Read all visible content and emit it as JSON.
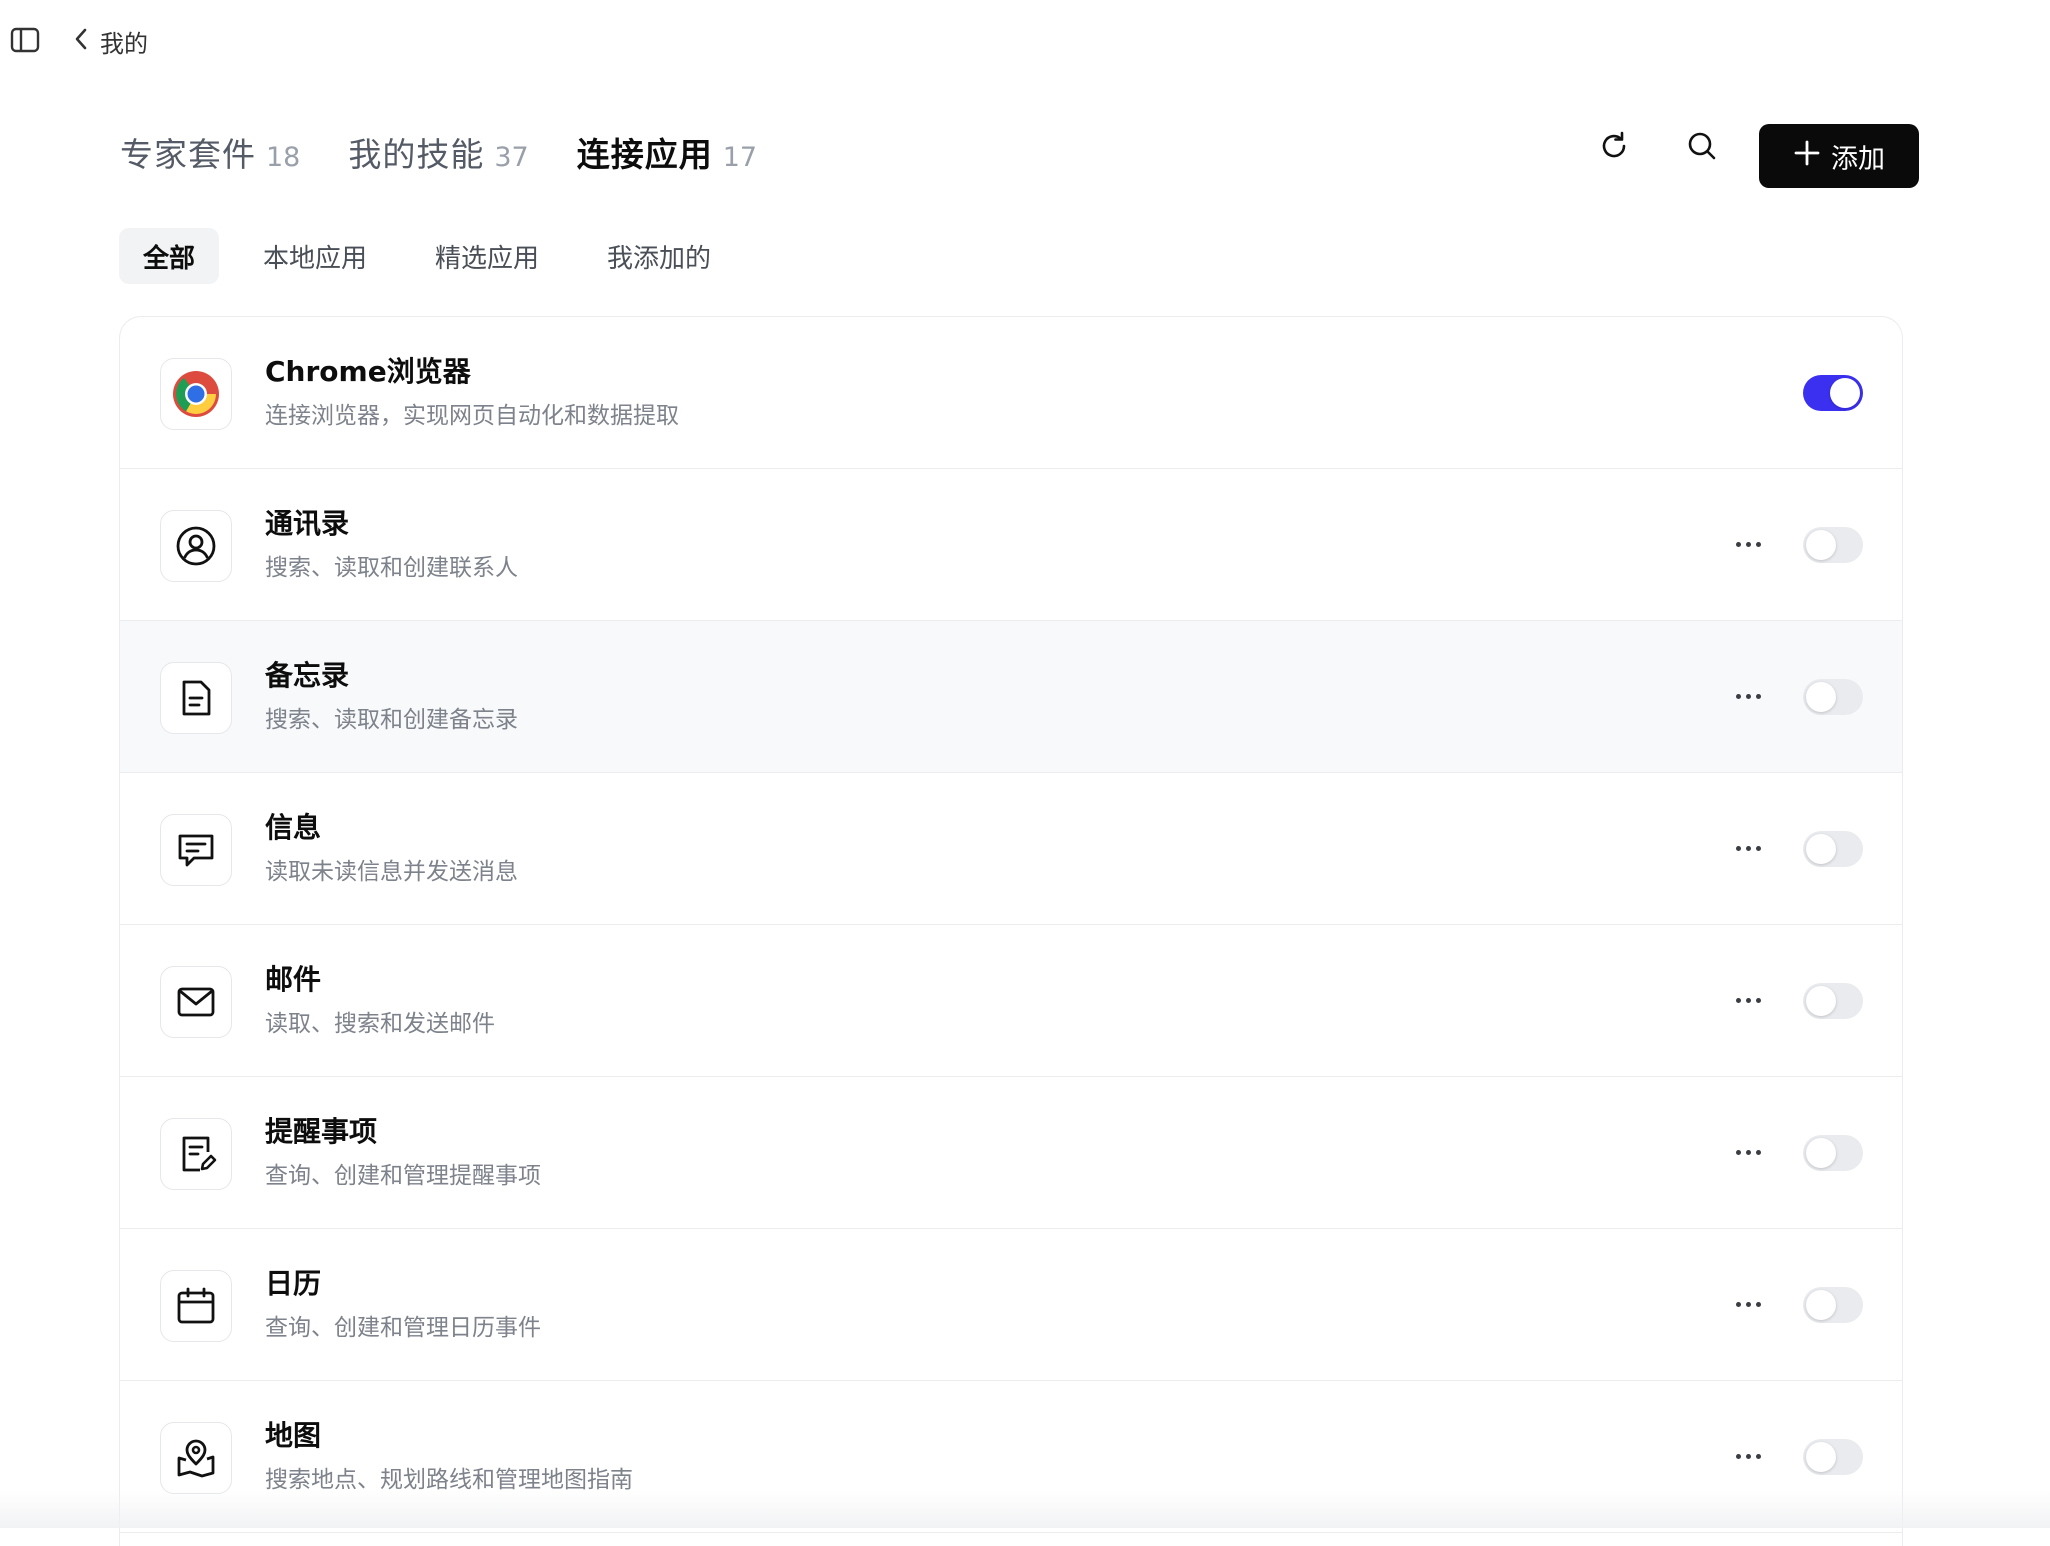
{
  "nav": {
    "back_label": "我的"
  },
  "main_tabs": [
    {
      "label": "专家套件",
      "count": "18",
      "active": false
    },
    {
      "label": "我的技能",
      "count": "37",
      "active": false
    },
    {
      "label": "连接应用",
      "count": "17",
      "active": true
    }
  ],
  "actions": {
    "add_label": "添加",
    "refresh_icon": "refresh-icon",
    "search_icon": "search-icon"
  },
  "sub_tabs": [
    {
      "label": "全部",
      "active": true
    },
    {
      "label": "本地应用",
      "active": false
    },
    {
      "label": "精选应用",
      "active": false
    },
    {
      "label": "我添加的",
      "active": false
    }
  ],
  "apps": [
    {
      "name": "Chrome浏览器",
      "desc": "连接浏览器，实现网页自动化和数据提取",
      "icon": "chrome-icon",
      "enabled": true,
      "has_more": false
    },
    {
      "name": "通讯录",
      "desc": "搜索、读取和创建联系人",
      "icon": "contacts-icon",
      "enabled": false,
      "has_more": true
    },
    {
      "name": "备忘录",
      "desc": "搜索、读取和创建备忘录",
      "icon": "notes-icon",
      "enabled": false,
      "has_more": true
    },
    {
      "name": "信息",
      "desc": "读取未读信息并发送消息",
      "icon": "message-icon",
      "enabled": false,
      "has_more": true
    },
    {
      "name": "邮件",
      "desc": "读取、搜索和发送邮件",
      "icon": "mail-icon",
      "enabled": false,
      "has_more": true
    },
    {
      "name": "提醒事项",
      "desc": "查询、创建和管理提醒事项",
      "icon": "reminders-icon",
      "enabled": false,
      "has_more": true
    },
    {
      "name": "日历",
      "desc": "查询、创建和管理日历事件",
      "icon": "calendar-icon",
      "enabled": false,
      "has_more": true
    },
    {
      "name": "地图",
      "desc": "搜索地点、规划路线和管理地图指南",
      "icon": "map-icon",
      "enabled": false,
      "has_more": true
    }
  ],
  "colors": {
    "toggle_on": "#3b30f0",
    "toggle_off": "#e9ebef",
    "add_button_bg": "#0a0a0a"
  }
}
